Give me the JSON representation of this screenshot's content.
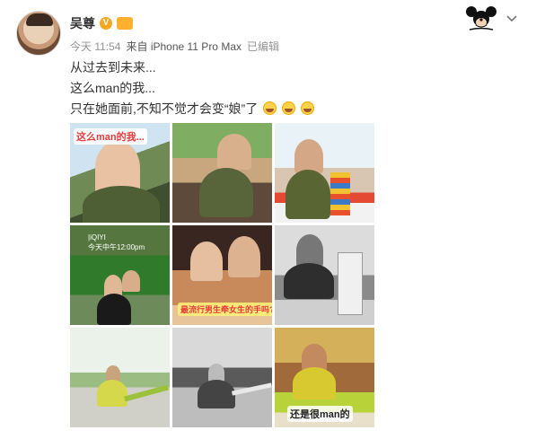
{
  "author": {
    "name": "吴尊",
    "verified_badge": "V"
  },
  "meta": {
    "time": "今天 11:54",
    "source": "来自 iPhone 11 Pro Max",
    "edited": "已编辑"
  },
  "post": {
    "lines": [
      "从过去到未来...",
      "这么man的我...",
      "只在她面前,不知不觉才会变“娘”了"
    ],
    "emoji": [
      "grinning-emoji",
      "grinning-emoji",
      "grinning-emoji"
    ]
  },
  "photos": {
    "p1_caption": "这么man的我...",
    "p4_poster_line1": "|iQIYI",
    "p4_poster_line2": "今天中午12:00pm",
    "p5_caption": "最流行男生牵女生的手吗?",
    "p9_caption": "还是很man的"
  },
  "colors": {
    "accent": "#f5a623",
    "caption_red": "#e63b3b",
    "meta_gray": "#939393"
  }
}
